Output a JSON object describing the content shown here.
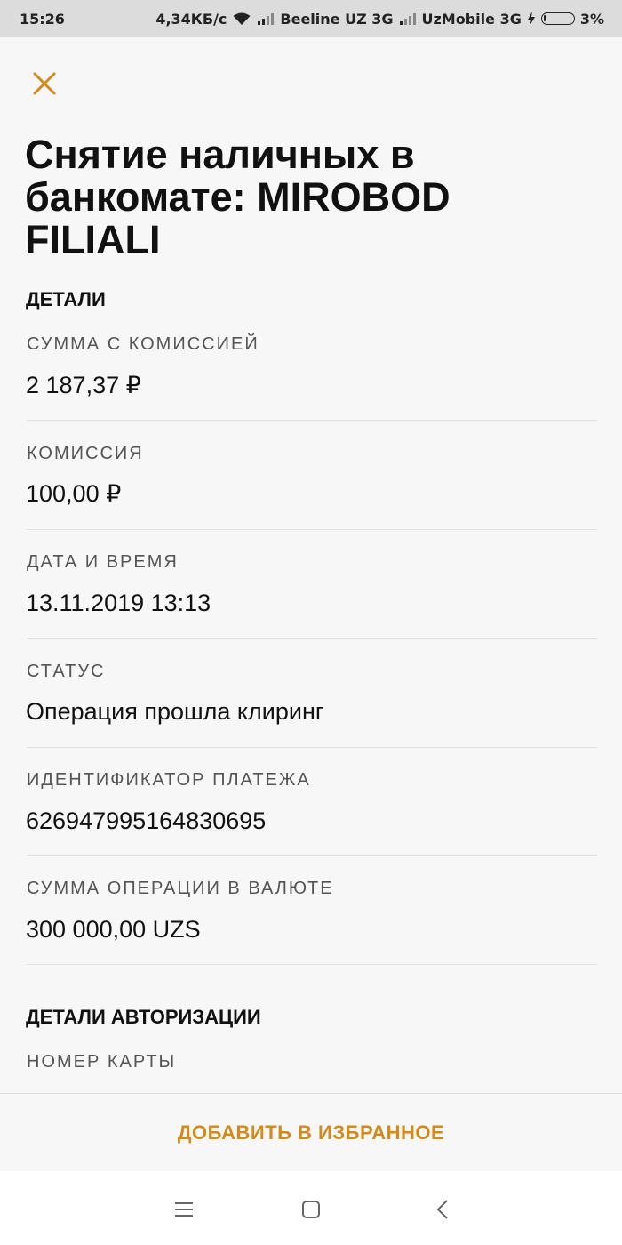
{
  "status_bar": {
    "time": "15:26",
    "speed": "4,34КБ/с",
    "carrier1": "Beeline UZ 3G",
    "carrier2": "UzMobile 3G",
    "battery": "3%"
  },
  "header": {
    "title": "Снятие наличных в банкомате: MIROBOD FILIALI"
  },
  "details": {
    "heading": "ДЕТАЛИ",
    "fields": [
      {
        "label": "СУММА С КОМИССИЕЙ",
        "value": "2 187,37 ₽"
      },
      {
        "label": "КОМИССИЯ",
        "value": "100,00 ₽"
      },
      {
        "label": "ДАТА И ВРЕМЯ",
        "value": "13.11.2019 13:13"
      },
      {
        "label": "СТАТУС",
        "value": "Операция прошла клиринг"
      },
      {
        "label": "ИДЕНТИФИКАТОР ПЛАТЕЖА",
        "value": "626947995164830695"
      },
      {
        "label": "СУММА ОПЕРАЦИИ В ВАЛЮТЕ",
        "value": "300 000,00 UZS"
      }
    ]
  },
  "auth_details": {
    "heading": "ДЕТАЛИ АВТОРИЗАЦИИ",
    "card_label": "НОМЕР КАРТЫ"
  },
  "actions": {
    "favorite_label": "ДОБАВИТЬ В ИЗБРАННОЕ"
  },
  "colors": {
    "accent": "#d28a1b",
    "background": "#f7f7f7",
    "status_bar": "#dcdcdc"
  },
  "icons": {
    "close": "close-icon",
    "wifi": "wifi-icon",
    "signal": "signal-icon",
    "charging": "charging-icon",
    "battery": "battery-icon",
    "menu": "menu-icon",
    "home": "home-icon",
    "back": "back-icon"
  }
}
